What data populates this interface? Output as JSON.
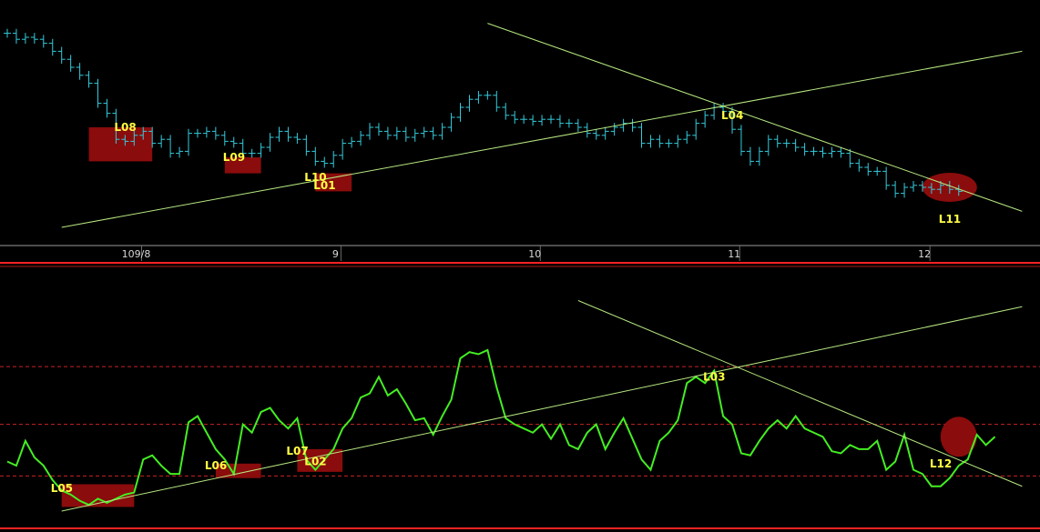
{
  "colors": {
    "background": "#000000",
    "price_bars": "#33ccdd",
    "oscillator_line": "#44ee22",
    "trendline": "#b6e880",
    "highlight_box": "#8a0c0c",
    "label_text": "#ffff44",
    "axis_text": "#d8d8d8",
    "separator_line": "#ff2222",
    "reference_dashed": "#cc2222"
  },
  "chart_data": [
    {
      "type": "ohlc",
      "panel": "price",
      "x_tick_labels": [
        {
          "index": 10,
          "label": "109/8"
        },
        {
          "index": 32,
          "label": "9"
        },
        {
          "index": 54,
          "label": "10"
        },
        {
          "index": 76,
          "label": "11"
        },
        {
          "index": 97,
          "label": "12"
        }
      ],
      "x_range": [
        0,
        112
      ],
      "y_range": [
        0,
        100
      ],
      "closes": [
        97,
        94,
        95,
        94,
        92,
        88,
        84,
        80,
        76,
        72,
        62,
        57,
        44,
        43,
        46,
        48,
        42,
        44,
        37,
        38,
        47,
        47,
        48,
        46,
        43,
        42,
        37,
        37,
        40,
        45,
        48,
        45,
        44,
        38,
        33,
        32,
        36,
        42,
        43,
        46,
        50,
        48,
        46,
        48,
        45,
        47,
        48,
        46,
        50,
        55,
        60,
        64,
        66,
        66,
        60,
        56,
        54,
        54,
        53,
        54,
        54,
        52,
        52,
        50,
        47,
        46,
        48,
        50,
        52,
        50,
        42,
        44,
        42,
        42,
        44,
        46,
        52,
        56,
        60,
        58,
        49,
        38,
        33,
        38,
        44,
        42,
        42,
        40,
        38,
        38,
        37,
        38,
        37,
        32,
        30,
        28,
        28,
        21,
        17,
        20,
        21,
        20,
        19,
        21,
        19,
        18
      ],
      "annotations": [
        {
          "text": "L08",
          "index": 13,
          "value": 50,
          "box": true,
          "box_start": 9,
          "box_end": 16,
          "box_low": 33,
          "box_high": 50
        },
        {
          "text": "L09",
          "index": 25,
          "value": 35,
          "box": true,
          "box_start": 24,
          "box_end": 28,
          "box_low": 27,
          "box_high": 35
        },
        {
          "text": "L10",
          "index": 34,
          "value": 25,
          "box": false
        },
        {
          "text": "L01",
          "index": 35,
          "value": 21,
          "box": true,
          "box_start": 34,
          "box_end": 38,
          "box_low": 18,
          "box_high": 27
        },
        {
          "text": "L04",
          "index": 80,
          "value": 56,
          "box": false
        },
        {
          "text": "L11",
          "index": 104,
          "value": 4,
          "box": false,
          "ellipse": true,
          "ellipse_cx": 104,
          "ellipse_cy": 20
        }
      ],
      "trendlines": [
        {
          "x1": 6,
          "y1": 0,
          "x2": 112,
          "y2": 88
        },
        {
          "x1": 53,
          "y1": 102,
          "x2": 112,
          "y2": 8
        }
      ]
    },
    {
      "type": "line",
      "panel": "oscillator",
      "x_range": [
        0,
        112
      ],
      "y_range": [
        0,
        100
      ],
      "reference_lines": [
        70,
        42,
        17
      ],
      "values": [
        24,
        22,
        34,
        26,
        22,
        15,
        10,
        8,
        5,
        3,
        6,
        4,
        6,
        8,
        9,
        25,
        27,
        22,
        18,
        18,
        43,
        46,
        38,
        30,
        25,
        18,
        42,
        38,
        48,
        50,
        44,
        40,
        45,
        25,
        20,
        25,
        30,
        40,
        45,
        55,
        57,
        65,
        56,
        59,
        52,
        44,
        45,
        37,
        46,
        54,
        74,
        77,
        76,
        78,
        60,
        45,
        42,
        40,
        38,
        42,
        35,
        42,
        32,
        30,
        38,
        42,
        30,
        38,
        45,
        35,
        25,
        20,
        34,
        38,
        44,
        62,
        65,
        62,
        68,
        46,
        42,
        28,
        27,
        34,
        40,
        44,
        40,
        46,
        40,
        38,
        36,
        29,
        28,
        32,
        30,
        30,
        34,
        20,
        24,
        37,
        20,
        18,
        12,
        12,
        16,
        22,
        25,
        37,
        32,
        36
      ],
      "annotations": [
        {
          "text": "L05",
          "index": 6,
          "value": 11,
          "box": true,
          "box_start": 6,
          "box_end": 14,
          "box_low": 2,
          "box_high": 13
        },
        {
          "text": "L06",
          "index": 23,
          "value": 22,
          "box": true,
          "box_start": 23,
          "box_end": 28,
          "box_low": 16,
          "box_high": 23
        },
        {
          "text": "L07",
          "index": 32,
          "value": 29,
          "box": true,
          "box_start": 32,
          "box_end": 37,
          "box_low": 19,
          "box_high": 30
        },
        {
          "text": "L02",
          "index": 34,
          "value": 24,
          "box": false
        },
        {
          "text": "L03",
          "index": 78,
          "value": 65,
          "box": false
        },
        {
          "text": "L12",
          "index": 103,
          "value": 23,
          "box": false,
          "ellipse": true,
          "ellipse_cx": 105,
          "ellipse_cy": 36
        }
      ],
      "trendlines": [
        {
          "x1": 6,
          "y1": 0,
          "x2": 112,
          "y2": 99
        },
        {
          "x1": 63,
          "y1": 102,
          "x2": 112,
          "y2": 12
        }
      ]
    }
  ]
}
